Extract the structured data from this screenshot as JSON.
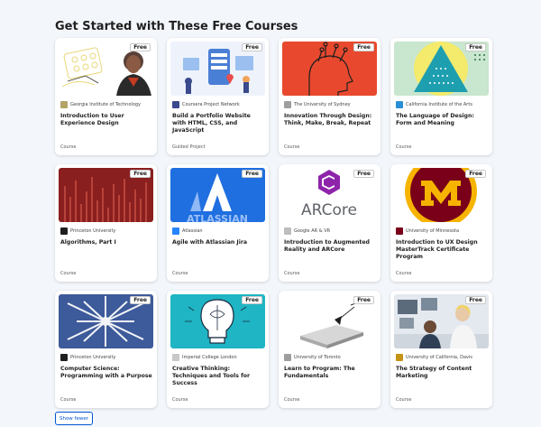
{
  "heading": "Get Started with These Free Courses",
  "badge": "Free",
  "show_fewer_label": "Show fewer",
  "accent_color": "#0056d2",
  "courses": [
    {
      "partner": "Georgia Institute of Technology",
      "title": "Introduction to User Experience Design",
      "type": "Course",
      "logo_color": "#b3a369"
    },
    {
      "partner": "Coursera Project Network",
      "title": "Build a Portfolio Website with HTML, CSS, and JavaScript",
      "type": "Guided Project",
      "logo_color": "#3a4a8c"
    },
    {
      "partner": "The University of Sydney",
      "title": "Innovation Through Design: Think, Make, Break, Repeat",
      "type": "Course",
      "logo_color": "#9e9e9e"
    },
    {
      "partner": "California Institute of the Arts",
      "title": "The Language of Design: Form and Meaning",
      "type": "Course",
      "logo_color": "#2a8fd6"
    },
    {
      "partner": "Princeton University",
      "title": "Algorithms, Part I",
      "type": "Course",
      "logo_color": "#1f1f1f"
    },
    {
      "partner": "Atlassian",
      "title": "Agile with Atlassian Jira",
      "type": "Course",
      "logo_color": "#2684ff"
    },
    {
      "partner": "Google AR & VR",
      "title": "Introduction to Augmented Reality and ARCore",
      "type": "Course",
      "logo_color": "#bdbdbd"
    },
    {
      "partner": "University of Minnesota",
      "title": "Introduction to UX Design MasterTrack Certificate Program",
      "type": "Course",
      "logo_color": "#7a0019"
    },
    {
      "partner": "Princeton University",
      "title": "Computer Science: Programming with a Purpose",
      "type": "Course",
      "logo_color": "#1f1f1f"
    },
    {
      "partner": "Imperial College London",
      "title": "Creative Thinking: Techniques and Tools for Success",
      "type": "Course",
      "logo_color": "#c8c8c8"
    },
    {
      "partner": "University of Toronto",
      "title": "Learn to Program: The Fundamentals",
      "type": "Course",
      "logo_color": "#9e9e9e"
    },
    {
      "partner": "University of California, Davis",
      "title": "The Strategy of Content Marketing",
      "type": "Course",
      "logo_color": "#c69214"
    }
  ],
  "thumb_text": {
    "atlassian": "ATLASSIAN",
    "arcore": "ARCore"
  }
}
